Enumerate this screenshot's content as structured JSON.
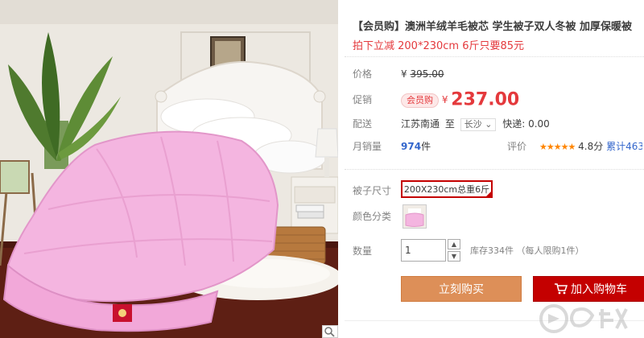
{
  "product": {
    "title": "【会员购】澳洲羊绒羊毛被芯 学生被子双人冬被 加厚保暖被",
    "subtitle": "拍下立减 200*230cm 6斤只要85元"
  },
  "pricing": {
    "original_label": "价格",
    "original_currency": "¥",
    "original_price": "395.00",
    "promo_label": "促销",
    "promo_badge": "会员购",
    "promo_currency": "¥",
    "promo_price": "237.00"
  },
  "shipping": {
    "label": "配送",
    "from": "江苏南通",
    "to_word": "至",
    "to_city": "长沙",
    "chevron": "⌄",
    "express_text": "快递: 0.00"
  },
  "sales": {
    "label": "月销量",
    "count": "974",
    "unit": "件",
    "rating_label": "评价",
    "stars": "★★★★★",
    "score": "4.8分",
    "cumulative": "累计463"
  },
  "options": {
    "size_label": "被子尺寸",
    "size_selected": "200X230cm总重6斤",
    "color_label": "颜色分类"
  },
  "quantity": {
    "label": "数量",
    "value": "1",
    "up": "▲",
    "down": "▼",
    "stock_text": "库存334件 （每人限购1件）"
  },
  "actions": {
    "buy_now": "立刻购买",
    "add_to_cart": "加入购物车"
  },
  "colors": {
    "accent_red": "#c40000",
    "price_red": "#e4393c",
    "buy_orange": "#dd8f58",
    "link_blue": "#3366cc",
    "star_orange": "#ff8500"
  },
  "icons": {
    "zoom": "magnifier-icon",
    "cart": "cart-icon",
    "size_check": "check-corner-icon",
    "watermark": "watermark-logo"
  }
}
